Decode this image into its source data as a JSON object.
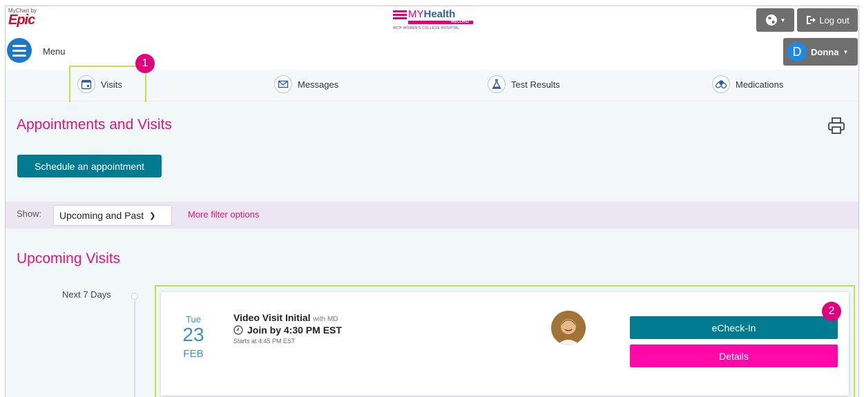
{
  "header": {
    "epic_small": "MyChart by",
    "epic_big": "Epic",
    "brand_my": "MY",
    "brand_health": "Health",
    "brand_record": "RECORD",
    "brand_hospital": "WCH WOMEN'S COLLEGE HOSPITAL",
    "menu_label": "Menu",
    "logout_label": "Log out",
    "user_initial": "D",
    "user_name": "Donna"
  },
  "nav": {
    "items": [
      {
        "label": "Visits",
        "icon": "calendar-icon"
      },
      {
        "label": "Messages",
        "icon": "envelope-icon"
      },
      {
        "label": "Test Results",
        "icon": "flask-icon"
      },
      {
        "label": "Medications",
        "icon": "pills-icon"
      }
    ]
  },
  "annotations": {
    "badge1": "1",
    "badge2": "2",
    "accent_color": "#c5de4b",
    "badge_color": "#e4007c"
  },
  "page": {
    "title": "Appointments and Visits",
    "schedule_label": "Schedule an appointment",
    "show_label": "Show:",
    "show_value": "Upcoming and Past",
    "more_filter": "More filter options",
    "upcoming_title": "Upcoming Visits",
    "timeline_label": "Next 7 Days"
  },
  "visit": {
    "dow": "Tue",
    "day": "23",
    "month": "FEB",
    "title": "Video Visit Initial",
    "with": "with MD",
    "join": "Join by 4:30 PM EST",
    "starts": "Starts at 4:45 PM EST",
    "echeckin_label": "eCheck-In",
    "details_label": "Details"
  },
  "colors": {
    "brand_pink": "#e0157d",
    "teal": "#007b8f",
    "details_pink": "#ff08a8",
    "date_blue": "#3b8fd9"
  }
}
